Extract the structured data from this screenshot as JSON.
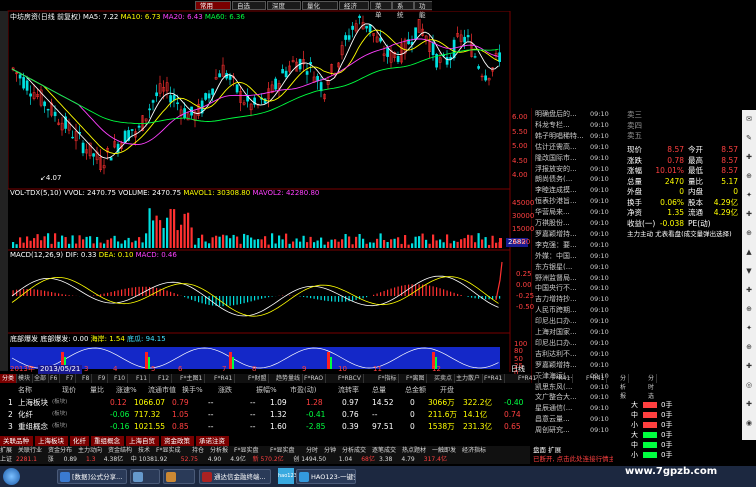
{
  "top_menu": [
    "常用",
    "自选",
    "深度",
    "量化",
    "经济",
    "菜单",
    "系统",
    "功能"
  ],
  "chart_header": {
    "title": "中坊房资(日线 前复权)",
    "ma5": "MA5: 7.22",
    "ma10": "MA10: 6.73",
    "ma20": "MA20: 6.43",
    "ma60": "MA60: 6.36"
  },
  "price_axis": [
    "6.00",
    "5.50",
    "5.00",
    "4.50",
    "4.00"
  ],
  "low_label": "4.07",
  "vol_header": {
    "vol_tdx": "VOL-TDX(5,10)",
    "vvol": "VVOL: 2470.75",
    "volume": "VOLUME: 2470.75",
    "mavol1": "MAVOL1: 30308.80",
    "mavol2": "MAVOL2: 42280.80"
  },
  "vol_axis": [
    "45000",
    "30000",
    "15000",
    "X100"
  ],
  "vol_badge": "2682",
  "macd_header": {
    "label": "MACD(12,26,9)",
    "dif": "DIF: 0.33",
    "dea": "DEA: 0.10",
    "macd": "MACD: 0.46"
  },
  "macd_axis": [
    "0.25",
    "0.00",
    "-0.25",
    "-0.50"
  ],
  "ind4_header": {
    "label": "底部爆发",
    "val1": "底部爆发: 0.00",
    "val2": "海岸: 1.54",
    "val3": "底瓜: 94.15"
  },
  "ind4_axis": [
    "100",
    "80",
    "50",
    "25",
    "0"
  ],
  "date_label": "2013/05/21",
  "date_row": [
    "2013年",
    "3",
    "4",
    "5",
    "6",
    "7",
    "8",
    "9",
    "10",
    "11",
    "12",
    "日线"
  ],
  "news_items": [
    [
      "明确盘后的...",
      "09:10"
    ],
    [
      "科龙专栏...",
      "09:10"
    ],
    [
      "韩子明唱稀特...",
      "09:10"
    ],
    [
      "估计还需高...",
      "09:10"
    ],
    [
      "隆改国际市...",
      "09:10"
    ],
    [
      "浮报放安的...",
      "09:10"
    ],
    [
      "朗尚债务(...",
      "09:10"
    ],
    [
      "李睦连成摸...",
      "09:10"
    ],
    [
      "恒表抄港旨...",
      "09:10"
    ],
    [
      "华营局来...",
      "09:10"
    ],
    [
      "万祺股份...",
      "09:10"
    ],
    [
      "罗嘉颖增持...",
      "09:10"
    ],
    [
      "李克强：要...",
      "09:10"
    ],
    [
      "外媒：中国...",
      "09:10"
    ],
    [
      "东方银星(...",
      "09:10"
    ],
    [
      "野洲监督局...",
      "09:10"
    ],
    [
      "中国央行不...",
      "09:10"
    ],
    [
      "吉力增持抄...",
      "09:10"
    ],
    [
      "人民币跨期...",
      "09:10"
    ],
    [
      "印尼出口办...",
      "09:10"
    ],
    [
      "上海对国家...",
      "09:10"
    ],
    [
      "印尼出口办...",
      "09:10"
    ],
    [
      "吉利达利不...",
      "09:10"
    ],
    [
      "罗嘉颖增持...",
      "09:10"
    ],
    [
      "天津海运(...",
      "09:10"
    ],
    [
      "凯思东风(...",
      "09:10"
    ],
    [
      "文广整合大...",
      "09:10"
    ],
    [
      "星辰通信(...",
      "09:10"
    ],
    [
      "昌意云量...",
      "09:10"
    ],
    [
      "周创研究...",
      "09:10"
    ]
  ],
  "order_book": [
    [
      "卖三",
      ""
    ],
    [
      "卖四",
      ""
    ],
    [
      "卖五",
      ""
    ]
  ],
  "quote": [
    [
      "现价",
      "8.57",
      "今开",
      "8.57"
    ],
    [
      "涨跌",
      "0.78",
      "最高",
      "8.57"
    ],
    [
      "涨幅",
      "10.01%",
      "最低",
      "8.57"
    ],
    [
      "总量",
      "2470",
      "量比",
      "5.17"
    ],
    [
      "外盘",
      "0",
      "内盘",
      "0"
    ],
    [
      "换手",
      "0.06%",
      "股本",
      "4.29亿"
    ],
    [
      "净资",
      "1.35",
      "流通",
      "4.29亿"
    ],
    [
      "收益(一)",
      "-0.038",
      "PE(动)",
      ""
    ]
  ],
  "quote_note": "主力主动 尤表看盘(成交量弹出选择)",
  "bottom_tabs": [
    "分类",
    "模块",
    "全部",
    "F6",
    "F7",
    "F8",
    "F9",
    "F10",
    "F11",
    "F12",
    "F*主图1",
    "F*R41",
    "F*财盟",
    "趋势量线",
    "F*RAO",
    "F*RBCV",
    "F*指标",
    "F*离图",
    "买卖点",
    "主力散户",
    "F*R41",
    "F*R41",
    "F*R41",
    "F*R41",
    "分析报表",
    "分时选择"
  ],
  "table_header": [
    "名称",
    "现价",
    "量比",
    "涨速%",
    "流通市值",
    "换手%",
    "涨跌",
    "振幅%",
    "市盈(动)",
    "流转率",
    "总量",
    "总金额",
    "开盘"
  ],
  "table_rows": [
    {
      "idx": "1",
      "name": "上海板块",
      "tag": "(板块)",
      "price": "0.12",
      "qr": "1066.07",
      "chg": "0.79",
      "speed": "--",
      "cap": "--",
      "turn": "1.09",
      "up": "1.28",
      "amp": "0.97",
      "pe": "14.52",
      "liu": "0",
      "vol": "3066万",
      "amt": "322.2亿",
      "open": "-0.40"
    },
    {
      "idx": "2",
      "name": "化纤",
      "tag": "(板块)",
      "price": "-0.06",
      "qr": "717.32",
      "chg": "1.05",
      "speed": "--",
      "cap": "--",
      "turn": "1.32",
      "up": "-0.41",
      "amp": "0.76",
      "pe": "--",
      "liu": "0",
      "vol": "211.6万",
      "amt": "14.1亿",
      "open": "0.74"
    },
    {
      "idx": "3",
      "name": "重组概念",
      "tag": "(板块)",
      "price": "-0.16",
      "qr": "1021.55",
      "chg": "0.85",
      "speed": "--",
      "cap": "--",
      "turn": "1.60",
      "up": "-2.85",
      "amp": "0.39",
      "pe": "97.51",
      "liu": "0",
      "vol": "1538万",
      "amt": "231.3亿",
      "open": "0.65"
    }
  ],
  "section_tabs": [
    "关联品种",
    "上海板块",
    "化纤",
    "重组概念",
    "上海自贸",
    "资金政策",
    "承诺注资"
  ],
  "status_line1": [
    "扩展",
    "关联行业",
    "资金分布",
    "主力动向",
    "资金结构",
    "技术",
    "F*显实成",
    "持仓",
    "分析报",
    "F*显实盘",
    "F*显实盘",
    "分时",
    "分钟",
    "分析成交",
    "逐笔成交",
    "热点题材",
    "一触即发",
    "经济指标"
  ],
  "status_line2": [
    "上证",
    "2281.1",
    "涨",
    "0.89",
    "1.3",
    "4.38亿",
    "中 10381.92",
    "52.75",
    "4.90",
    "4.9亿",
    "新 570.2亿",
    "创 1494.50",
    "1.04",
    "68亿",
    "3.38",
    "4.79",
    "317.4亿"
  ],
  "status_tail": "已断开, 点击此处连接行情主站",
  "side_status": [
    "盘面",
    "扩展"
  ],
  "taskbar": [
    {
      "label": "[数据]公式分享...",
      "color": "#3a7ad0"
    },
    {
      "label": "",
      "color": "#6699cc"
    },
    {
      "label": "",
      "color": "#cc8833"
    },
    {
      "label": "通达信金融终端...",
      "color": "#aa2222"
    },
    {
      "label": "HAO123-一键安...",
      "color": "#3399dd"
    }
  ],
  "taskbar_hao": "hao123",
  "watermark": "www.7gpzb.com",
  "mind_rows": [
    [
      "大",
      "0手",
      "#ff4040"
    ],
    [
      "中",
      "0手",
      "#ff4040"
    ],
    [
      "小",
      "0手",
      "#ff4040"
    ],
    [
      "大",
      "0手",
      "#00ff40"
    ],
    [
      "中",
      "0手",
      "#00ff40"
    ],
    [
      "小",
      "0手",
      "#00ff40"
    ]
  ],
  "right_icons": [
    "✉",
    "✎",
    "✚",
    "⊕",
    "✦",
    "✚",
    "⊕",
    "▲",
    "▼",
    "✚",
    "⊕",
    "✦",
    "⊕",
    "✚",
    "◎",
    "✚",
    "◉"
  ]
}
